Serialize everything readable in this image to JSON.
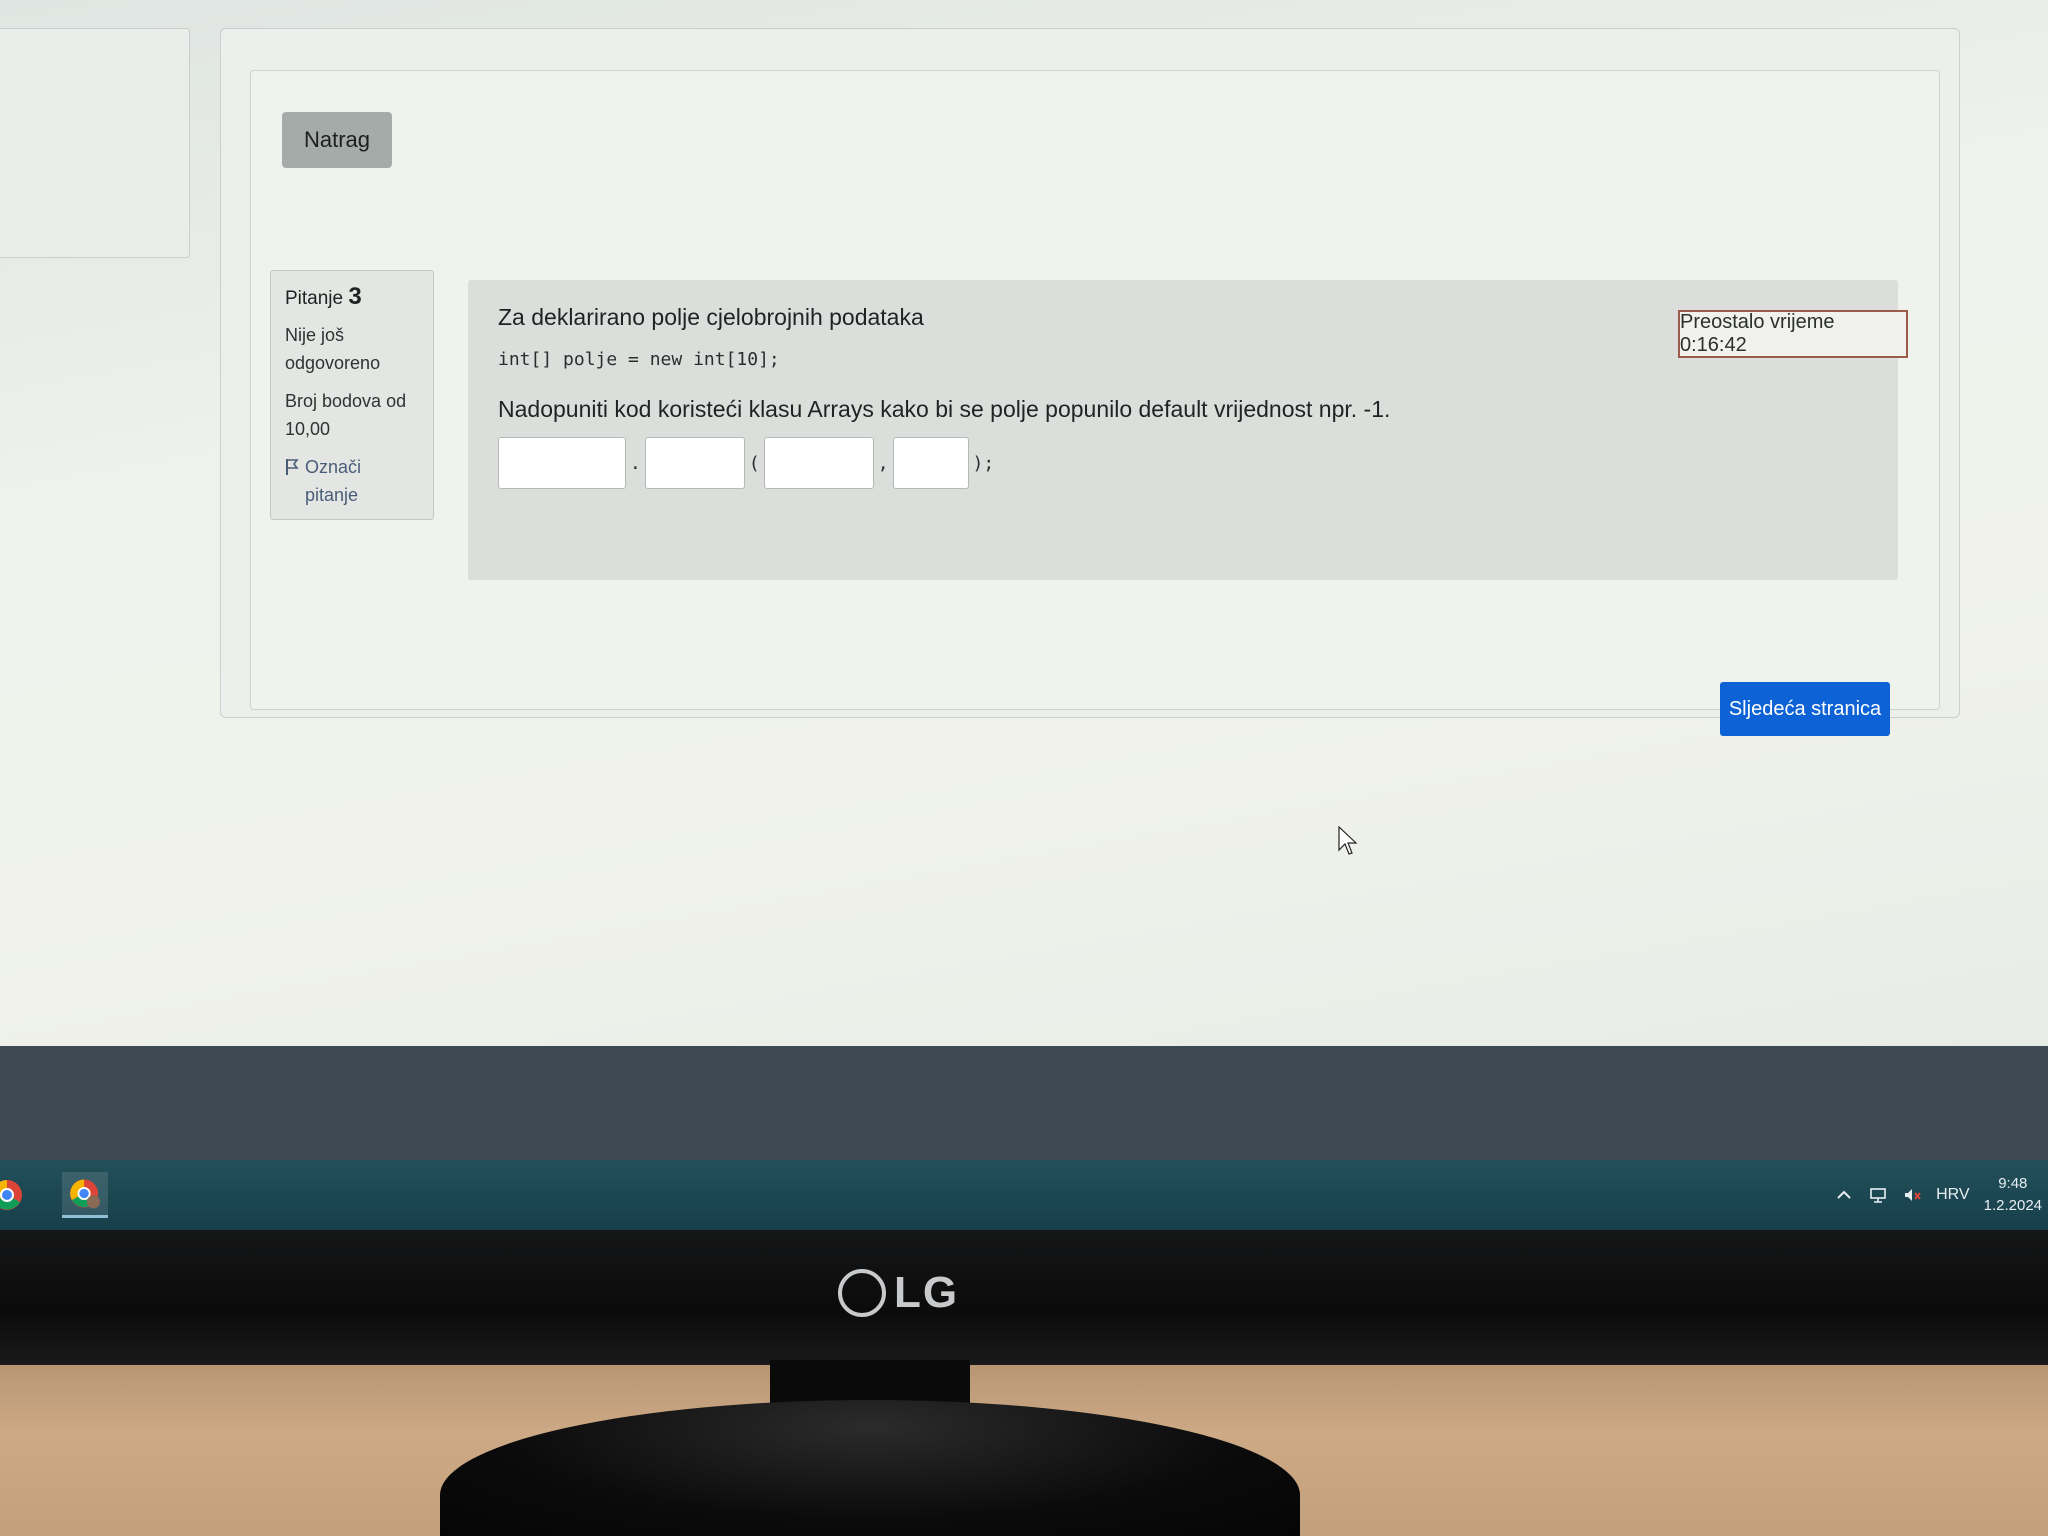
{
  "page": {
    "back_label": "Natrag",
    "next_label": "Sljedeća stranica",
    "timer_text": "Preostalo vrijeme 0:16:42"
  },
  "question_info": {
    "label": "Pitanje",
    "number": "3",
    "state": "Nije još odgovoreno",
    "grade": "Broj bodova od 10,00",
    "flag_label": "Označi pitanje"
  },
  "question": {
    "intro": "Za deklarirano polje cjelobrojnih podataka",
    "code": "int[] polje = new int[10];",
    "instruction": "Nadopuniti kod koristeći klasu Arrays kako bi se polje popunilo default vrijednost npr. -1.",
    "separators": [
      ".",
      "(",
      ",",
      ");"
    ],
    "blanks": [
      "",
      "",
      "",
      ""
    ]
  },
  "taskbar": {
    "language": "HRV",
    "time": "9:48",
    "date": "1.2.2024"
  },
  "monitor": {
    "brand": "LG"
  },
  "colors": {
    "next_button": "#0d63d6",
    "back_button": "#a5aba8",
    "timer_border": "#9b5a4a",
    "taskbar": "#173f4b"
  }
}
